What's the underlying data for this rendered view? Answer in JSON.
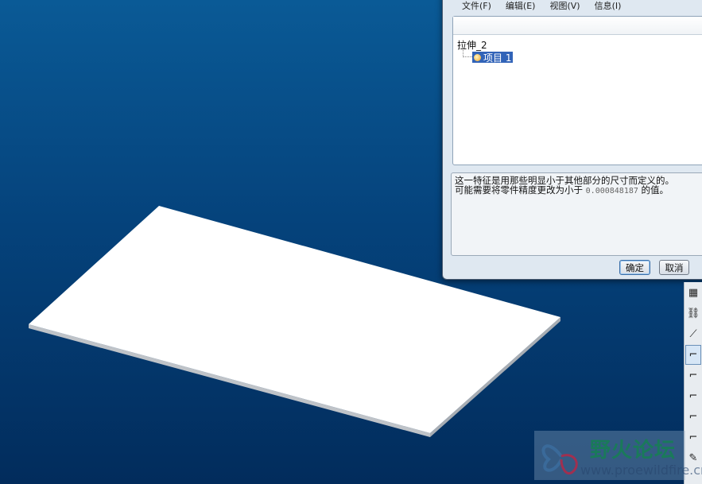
{
  "dialog": {
    "menu": [
      "文件(F)",
      "编辑(E)",
      "视图(V)",
      "信息(I)"
    ],
    "tree": {
      "root": "拉伸_2",
      "child": "项目 1"
    },
    "message": {
      "line1": "这一特征是用那些明显小于其他部分的尺寸而定义的。",
      "line2_prefix": "可能需要将零件精度更改为小于",
      "value": "0.000848187",
      "line2_suffix": "的值。"
    },
    "ok_label": "确定",
    "cancel_label": "取消"
  },
  "toolbar": {
    "icons": [
      "grid-icon",
      "chain-icon",
      "sketch-icon",
      "edge-solid-icon",
      "edge-dashdot-icon",
      "edge-dashed-icon",
      "edge-plain-icon",
      "edge-wavy-icon",
      "edit-icon"
    ]
  },
  "watermark": {
    "title": "野火论坛",
    "url": "www.proewildfire.cn"
  }
}
